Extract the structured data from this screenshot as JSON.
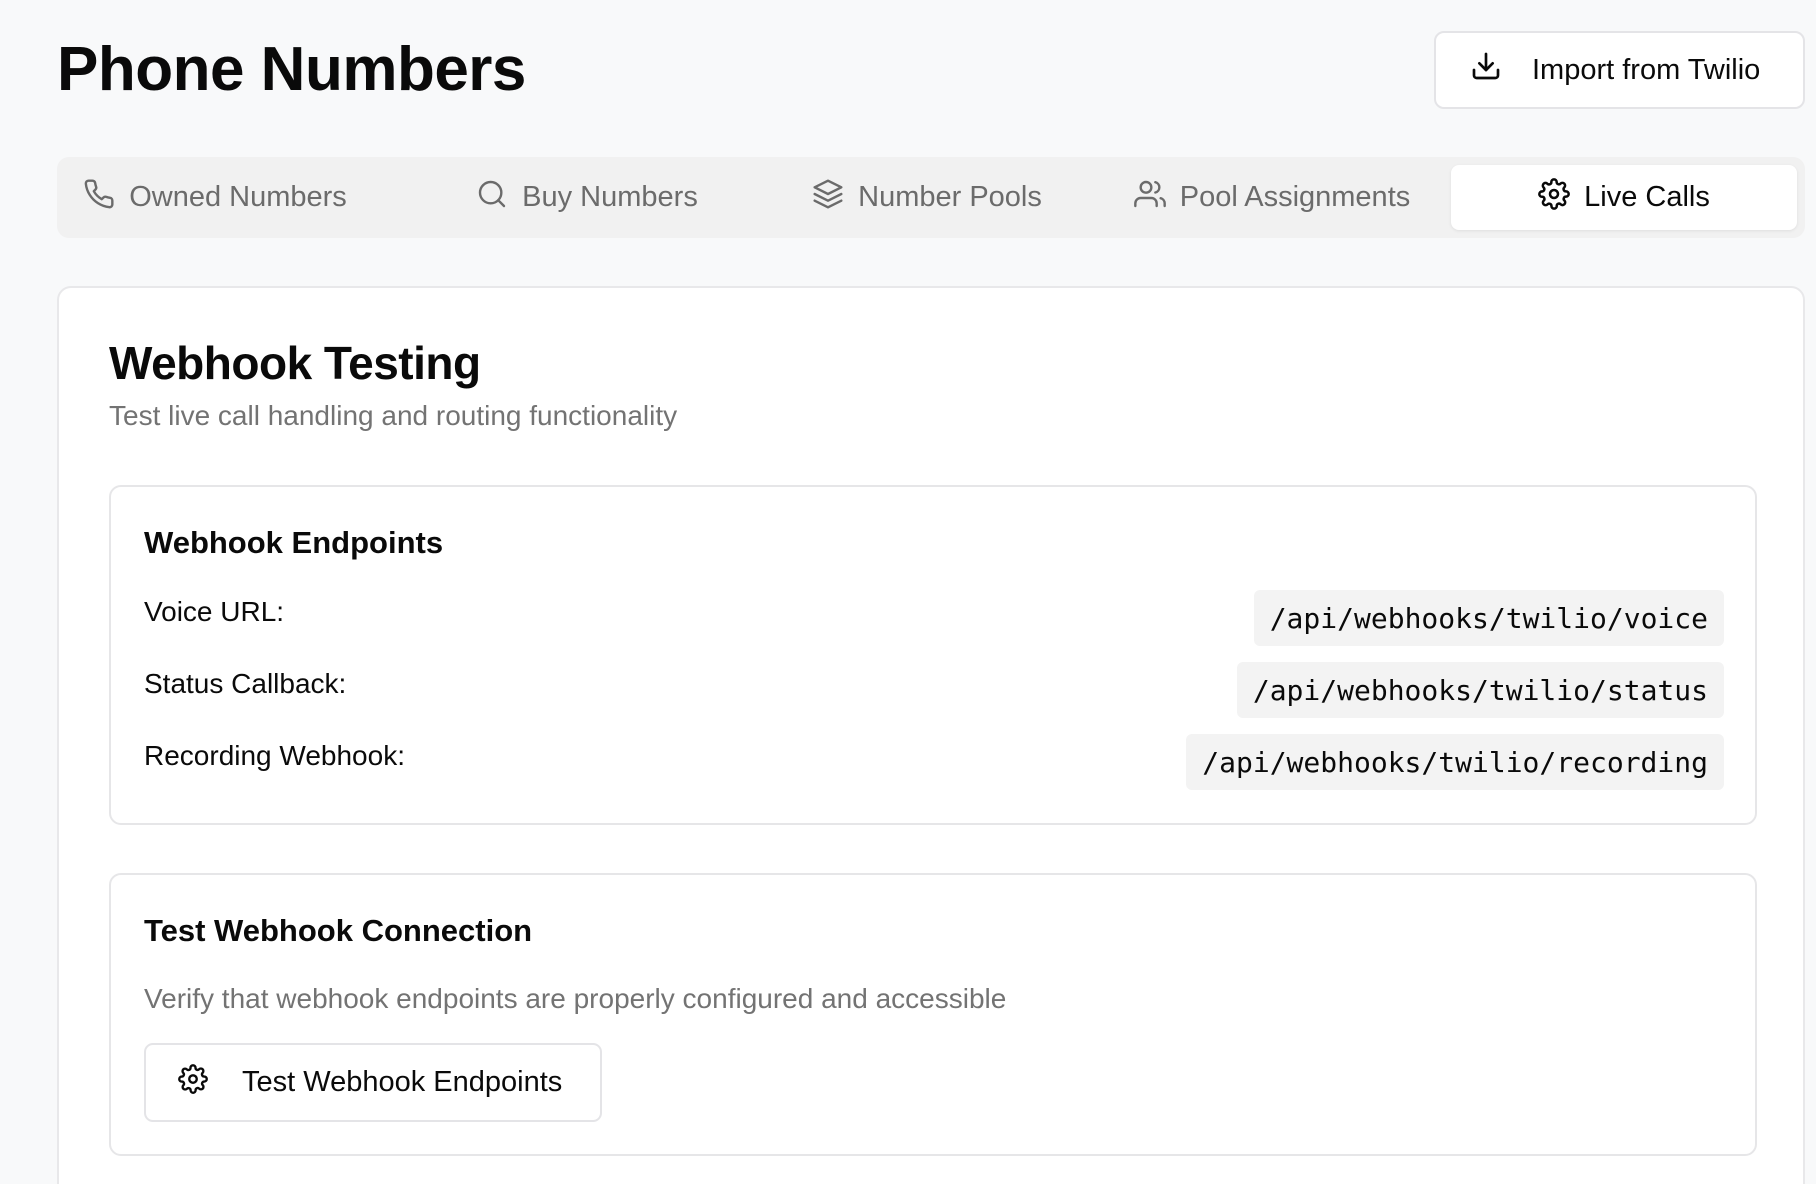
{
  "header": {
    "title": "Phone Numbers",
    "import_button": "Import from Twilio"
  },
  "tabs": [
    {
      "label": "Owned Numbers",
      "icon": "phone-icon",
      "active": false
    },
    {
      "label": "Buy Numbers",
      "icon": "search-icon",
      "active": false
    },
    {
      "label": "Number Pools",
      "icon": "layers-icon",
      "active": false
    },
    {
      "label": "Pool Assignments",
      "icon": "users-icon",
      "active": false
    },
    {
      "label": "Live Calls",
      "icon": "gear-icon",
      "active": true
    }
  ],
  "main": {
    "title": "Webhook Testing",
    "subtitle": "Test live call handling and routing functionality",
    "endpoints": {
      "title": "Webhook Endpoints",
      "rows": [
        {
          "label": "Voice URL:",
          "value": "/api/webhooks/twilio/voice"
        },
        {
          "label": "Status Callback:",
          "value": "/api/webhooks/twilio/status"
        },
        {
          "label": "Recording Webhook:",
          "value": "/api/webhooks/twilio/recording"
        }
      ]
    },
    "test": {
      "title": "Test Webhook Connection",
      "description": "Verify that webhook endpoints are properly configured and accessible",
      "button": "Test Webhook Endpoints"
    }
  },
  "colors": {
    "background": "#f8f9fa",
    "text": "#0a0a0a",
    "muted": "#737373",
    "border": "#e4e4e7",
    "tab_bg": "#f1f1f1",
    "code_bg": "#f3f3f3"
  }
}
